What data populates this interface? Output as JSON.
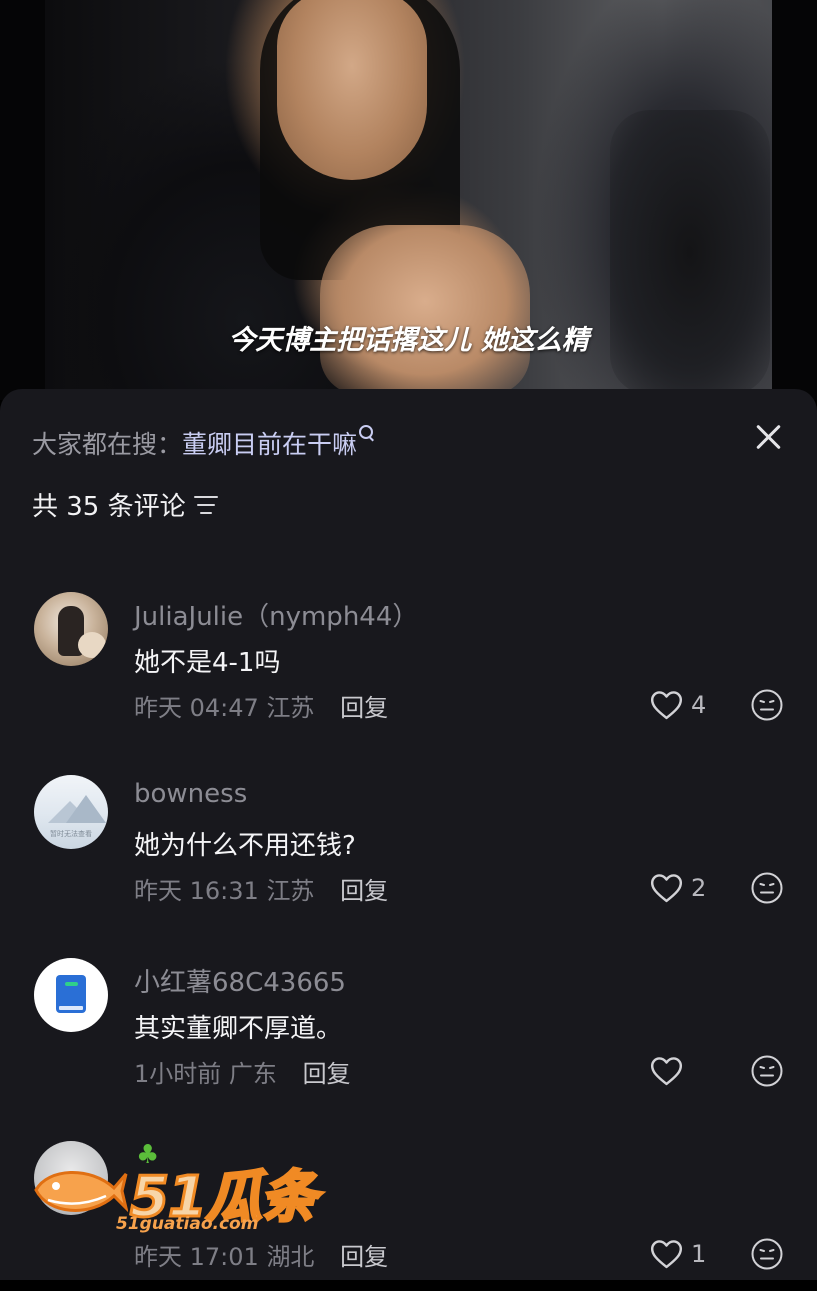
{
  "video": {
    "subtitle": "今天博主把话撂这儿 她这么精"
  },
  "sheet": {
    "search_prefix": "大家都在搜：",
    "search_keyword": "董卿目前在干嘛",
    "count_label": "共 35 条评论"
  },
  "comments": [
    {
      "username": "JuliaJulie（nymph44）",
      "text": "她不是4-1吗",
      "time": "昨天 04:47",
      "location": "江苏",
      "reply_label": "回复",
      "likes": "4"
    },
    {
      "username": "bowness",
      "text": "她为什么不用还钱?",
      "time": "昨天 16:31",
      "location": "江苏",
      "reply_label": "回复",
      "likes": "2",
      "avatar_text": "暂时无法查看"
    },
    {
      "username": "小红薯68C43665",
      "text": "其实董卿不厚道。",
      "time": "1小时前",
      "location": "广东",
      "reply_label": "回复",
      "likes": ""
    },
    {
      "username": "",
      "text": "",
      "time": "昨天 17:01",
      "location": "湖北",
      "reply_label": "回复",
      "likes": "1"
    }
  ],
  "watermark": {
    "brand": "51瓜条",
    "url": "51guatiao.com"
  },
  "colors": {
    "sheet_bg": "#18181d",
    "keyword": "#c9cdf2",
    "watermark_orange": "#f08a24"
  }
}
